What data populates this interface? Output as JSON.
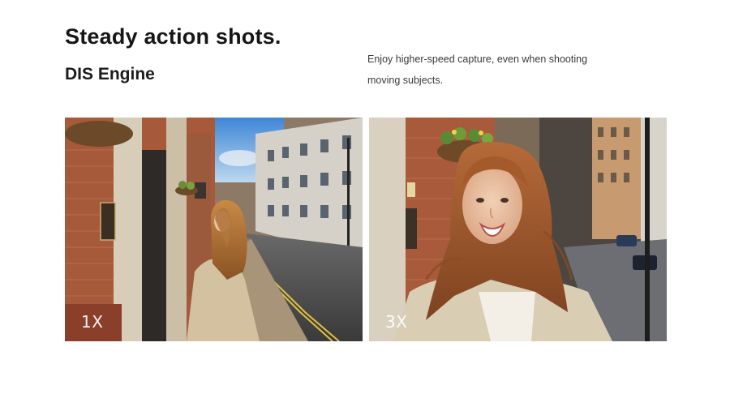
{
  "heading": "Steady action shots.",
  "subheading": "DIS Engine",
  "description_line1": "Enjoy higher-speed capture, even when shooting",
  "description_line2": "moving subjects.",
  "photos": [
    {
      "zoom_label": "1X",
      "alt": "street-photo"
    },
    {
      "zoom_label": "3X",
      "alt": "portrait-photo"
    }
  ]
}
